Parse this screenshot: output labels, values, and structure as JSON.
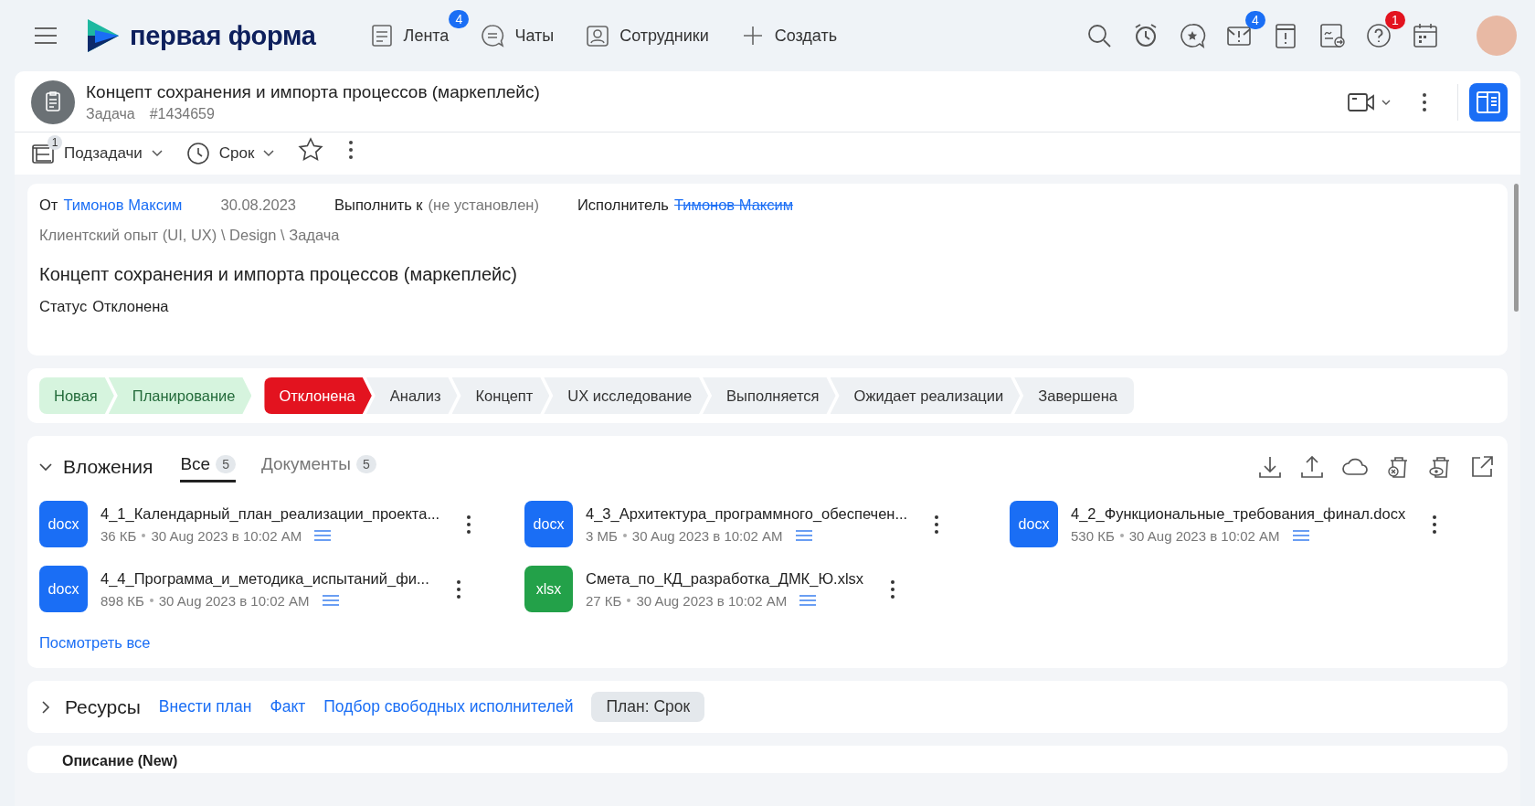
{
  "topbar": {
    "brand": "первая форма",
    "nav": [
      {
        "label": "Лента",
        "badge": "4"
      },
      {
        "label": "Чаты"
      },
      {
        "label": "Сотрудники"
      },
      {
        "label": "Создать"
      }
    ],
    "notifications": {
      "badge": "4"
    },
    "help": {
      "badge": "1"
    }
  },
  "task": {
    "title": "Концепт сохранения и импорта процессов (маркеплейс)",
    "type": "Задача",
    "number": "#1434659",
    "subtasks": {
      "label": "Подзадачи",
      "count": "1"
    },
    "deadline": {
      "label": "Срок"
    },
    "starred": false
  },
  "info": {
    "from_label": "От",
    "author": "Тимонов Максим",
    "date": "30.08.2023",
    "due_label": "Выполнить к",
    "due_value": "(не установлен)",
    "executor_label": "Исполнитель",
    "executor": "Тимонов Максим",
    "executor_struck": true,
    "path": "Клиентский опыт (UI, UX) \\ Design \\ Задача",
    "heading": "Концепт сохранения и импорта процессов (маркеплейс)",
    "status_label": "Статус",
    "status_value": "Отклонена"
  },
  "stages": [
    {
      "label": "Новая",
      "completed": true,
      "selected": false
    },
    {
      "label": "Планирование",
      "completed": true,
      "selected": false
    },
    {
      "label": "Отклонена",
      "completed": false,
      "selected": true
    },
    {
      "label": "Анализ",
      "completed": false,
      "selected": false
    },
    {
      "label": "Концепт",
      "completed": false,
      "selected": false
    },
    {
      "label": "UX исследование",
      "completed": false,
      "selected": false
    },
    {
      "label": "Выполняется",
      "completed": false,
      "selected": false
    },
    {
      "label": "Ожидает реализации",
      "completed": false,
      "selected": false
    },
    {
      "label": "Завершена",
      "completed": false,
      "selected": false
    }
  ],
  "attachments": {
    "title": "Вложения",
    "expanded": true,
    "tabs": [
      {
        "label": "Все",
        "count": "5",
        "selected": true
      },
      {
        "label": "Документы",
        "count": "5",
        "selected": false
      }
    ],
    "files": [
      {
        "type": "docx",
        "name": "4_1_Календарный_план_реализации_проекта...",
        "size": "36 КБ",
        "date": "30 Aug 2023 в 10:02 AM"
      },
      {
        "type": "docx",
        "name": "4_3_Архитектура_программного_обеспечен...",
        "size": "3 МБ",
        "date": "30 Aug 2023 в 10:02 AM"
      },
      {
        "type": "docx",
        "name": "4_2_Функциональные_требования_финал.docx",
        "size": "530 КБ",
        "date": "30 Aug 2023 в 10:02 AM"
      },
      {
        "type": "docx",
        "name": "4_4_Программа_и_методика_испытаний_фи...",
        "size": "898 КБ",
        "date": "30 Aug 2023 в 10:02 AM"
      },
      {
        "type": "xlsx",
        "name": "Смета_по_КД_разработка_ДМК_Ю.xlsx",
        "size": "27 КБ",
        "date": "30 Aug 2023 в 10:02 AM"
      }
    ],
    "view_all": "Посмотреть все"
  },
  "resources": {
    "title": "Ресурсы",
    "expanded": false,
    "links": [
      "Внести план",
      "Факт",
      "Подбор свободных исполнителей"
    ],
    "chip": "План: Срок"
  },
  "description": {
    "title": "Описание (New)"
  }
}
